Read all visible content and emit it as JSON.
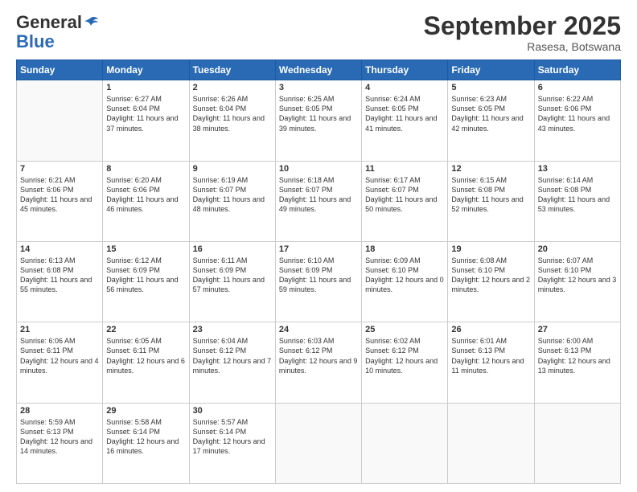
{
  "logo": {
    "general": "General",
    "blue": "Blue"
  },
  "header": {
    "month": "September 2025",
    "location": "Rasesa, Botswana"
  },
  "weekdays": [
    "Sunday",
    "Monday",
    "Tuesday",
    "Wednesday",
    "Thursday",
    "Friday",
    "Saturday"
  ],
  "weeks": [
    [
      {
        "day": "",
        "sunrise": "",
        "sunset": "",
        "daylight": ""
      },
      {
        "day": "1",
        "sunrise": "Sunrise: 6:27 AM",
        "sunset": "Sunset: 6:04 PM",
        "daylight": "Daylight: 11 hours and 37 minutes."
      },
      {
        "day": "2",
        "sunrise": "Sunrise: 6:26 AM",
        "sunset": "Sunset: 6:04 PM",
        "daylight": "Daylight: 11 hours and 38 minutes."
      },
      {
        "day": "3",
        "sunrise": "Sunrise: 6:25 AM",
        "sunset": "Sunset: 6:05 PM",
        "daylight": "Daylight: 11 hours and 39 minutes."
      },
      {
        "day": "4",
        "sunrise": "Sunrise: 6:24 AM",
        "sunset": "Sunset: 6:05 PM",
        "daylight": "Daylight: 11 hours and 41 minutes."
      },
      {
        "day": "5",
        "sunrise": "Sunrise: 6:23 AM",
        "sunset": "Sunset: 6:05 PM",
        "daylight": "Daylight: 11 hours and 42 minutes."
      },
      {
        "day": "6",
        "sunrise": "Sunrise: 6:22 AM",
        "sunset": "Sunset: 6:06 PM",
        "daylight": "Daylight: 11 hours and 43 minutes."
      }
    ],
    [
      {
        "day": "7",
        "sunrise": "Sunrise: 6:21 AM",
        "sunset": "Sunset: 6:06 PM",
        "daylight": "Daylight: 11 hours and 45 minutes."
      },
      {
        "day": "8",
        "sunrise": "Sunrise: 6:20 AM",
        "sunset": "Sunset: 6:06 PM",
        "daylight": "Daylight: 11 hours and 46 minutes."
      },
      {
        "day": "9",
        "sunrise": "Sunrise: 6:19 AM",
        "sunset": "Sunset: 6:07 PM",
        "daylight": "Daylight: 11 hours and 48 minutes."
      },
      {
        "day": "10",
        "sunrise": "Sunrise: 6:18 AM",
        "sunset": "Sunset: 6:07 PM",
        "daylight": "Daylight: 11 hours and 49 minutes."
      },
      {
        "day": "11",
        "sunrise": "Sunrise: 6:17 AM",
        "sunset": "Sunset: 6:07 PM",
        "daylight": "Daylight: 11 hours and 50 minutes."
      },
      {
        "day": "12",
        "sunrise": "Sunrise: 6:15 AM",
        "sunset": "Sunset: 6:08 PM",
        "daylight": "Daylight: 11 hours and 52 minutes."
      },
      {
        "day": "13",
        "sunrise": "Sunrise: 6:14 AM",
        "sunset": "Sunset: 6:08 PM",
        "daylight": "Daylight: 11 hours and 53 minutes."
      }
    ],
    [
      {
        "day": "14",
        "sunrise": "Sunrise: 6:13 AM",
        "sunset": "Sunset: 6:08 PM",
        "daylight": "Daylight: 11 hours and 55 minutes."
      },
      {
        "day": "15",
        "sunrise": "Sunrise: 6:12 AM",
        "sunset": "Sunset: 6:09 PM",
        "daylight": "Daylight: 11 hours and 56 minutes."
      },
      {
        "day": "16",
        "sunrise": "Sunrise: 6:11 AM",
        "sunset": "Sunset: 6:09 PM",
        "daylight": "Daylight: 11 hours and 57 minutes."
      },
      {
        "day": "17",
        "sunrise": "Sunrise: 6:10 AM",
        "sunset": "Sunset: 6:09 PM",
        "daylight": "Daylight: 11 hours and 59 minutes."
      },
      {
        "day": "18",
        "sunrise": "Sunrise: 6:09 AM",
        "sunset": "Sunset: 6:10 PM",
        "daylight": "Daylight: 12 hours and 0 minutes."
      },
      {
        "day": "19",
        "sunrise": "Sunrise: 6:08 AM",
        "sunset": "Sunset: 6:10 PM",
        "daylight": "Daylight: 12 hours and 2 minutes."
      },
      {
        "day": "20",
        "sunrise": "Sunrise: 6:07 AM",
        "sunset": "Sunset: 6:10 PM",
        "daylight": "Daylight: 12 hours and 3 minutes."
      }
    ],
    [
      {
        "day": "21",
        "sunrise": "Sunrise: 6:06 AM",
        "sunset": "Sunset: 6:11 PM",
        "daylight": "Daylight: 12 hours and 4 minutes."
      },
      {
        "day": "22",
        "sunrise": "Sunrise: 6:05 AM",
        "sunset": "Sunset: 6:11 PM",
        "daylight": "Daylight: 12 hours and 6 minutes."
      },
      {
        "day": "23",
        "sunrise": "Sunrise: 6:04 AM",
        "sunset": "Sunset: 6:12 PM",
        "daylight": "Daylight: 12 hours and 7 minutes."
      },
      {
        "day": "24",
        "sunrise": "Sunrise: 6:03 AM",
        "sunset": "Sunset: 6:12 PM",
        "daylight": "Daylight: 12 hours and 9 minutes."
      },
      {
        "day": "25",
        "sunrise": "Sunrise: 6:02 AM",
        "sunset": "Sunset: 6:12 PM",
        "daylight": "Daylight: 12 hours and 10 minutes."
      },
      {
        "day": "26",
        "sunrise": "Sunrise: 6:01 AM",
        "sunset": "Sunset: 6:13 PM",
        "daylight": "Daylight: 12 hours and 11 minutes."
      },
      {
        "day": "27",
        "sunrise": "Sunrise: 6:00 AM",
        "sunset": "Sunset: 6:13 PM",
        "daylight": "Daylight: 12 hours and 13 minutes."
      }
    ],
    [
      {
        "day": "28",
        "sunrise": "Sunrise: 5:59 AM",
        "sunset": "Sunset: 6:13 PM",
        "daylight": "Daylight: 12 hours and 14 minutes."
      },
      {
        "day": "29",
        "sunrise": "Sunrise: 5:58 AM",
        "sunset": "Sunset: 6:14 PM",
        "daylight": "Daylight: 12 hours and 16 minutes."
      },
      {
        "day": "30",
        "sunrise": "Sunrise: 5:57 AM",
        "sunset": "Sunset: 6:14 PM",
        "daylight": "Daylight: 12 hours and 17 minutes."
      },
      {
        "day": "",
        "sunrise": "",
        "sunset": "",
        "daylight": ""
      },
      {
        "day": "",
        "sunrise": "",
        "sunset": "",
        "daylight": ""
      },
      {
        "day": "",
        "sunrise": "",
        "sunset": "",
        "daylight": ""
      },
      {
        "day": "",
        "sunrise": "",
        "sunset": "",
        "daylight": ""
      }
    ]
  ]
}
